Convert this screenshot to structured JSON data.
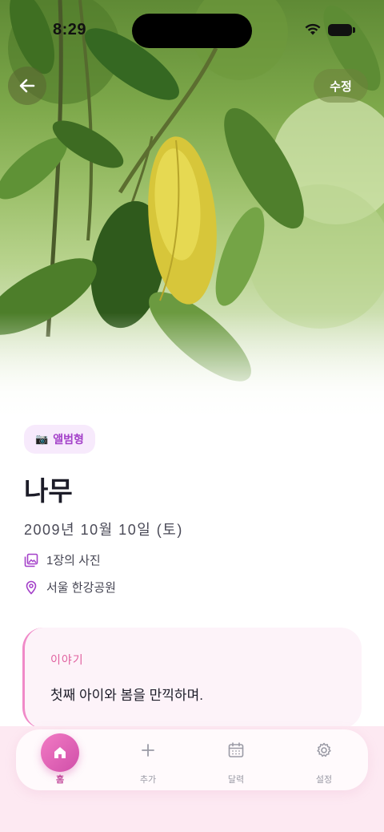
{
  "status_bar": {
    "time": "8:29"
  },
  "header": {
    "back_icon": "arrow-left-icon",
    "edit_label": "수정"
  },
  "record": {
    "type_chip": {
      "icon": "📷",
      "label": "앨범형"
    },
    "title": "나무",
    "date": "2009년 10월 10일 (토)",
    "photos": {
      "icon": "photo-stack-icon",
      "text": "1장의 사진"
    },
    "place": {
      "icon": "location-pin-icon",
      "text": "서울 한강공원"
    },
    "story": {
      "label": "이야기",
      "text": "첫째 아이와 봄을 만끽하며."
    }
  },
  "nav": {
    "items": [
      {
        "icon": "home-icon",
        "label": "홈",
        "active": true
      },
      {
        "icon": "plus-icon",
        "label": "추가",
        "active": false
      },
      {
        "icon": "calendar-icon",
        "label": "달력",
        "active": false
      },
      {
        "icon": "gear-icon",
        "label": "설정",
        "active": false
      }
    ]
  },
  "colors": {
    "accent": "#a441c9",
    "home_button": "#e460b8",
    "story_label": "#e0609f",
    "nav_background": "#fde9f2"
  }
}
